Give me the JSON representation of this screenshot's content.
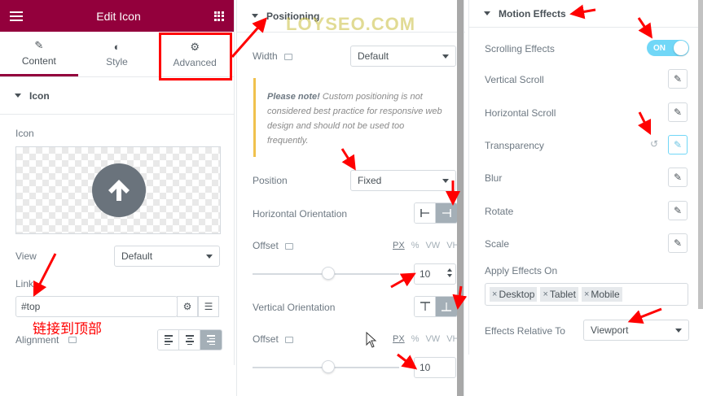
{
  "panel1": {
    "header_title": "Edit Icon",
    "tabs": [
      {
        "label": "Content",
        "icon": "pencil-icon",
        "active": true
      },
      {
        "label": "Style",
        "icon": "contrast-icon",
        "active": false
      },
      {
        "label": "Advanced",
        "icon": "gear-icon",
        "active": false
      }
    ],
    "section_title": "Icon",
    "icon_label": "Icon",
    "view_label": "View",
    "view_value": "Default",
    "link_label": "Link",
    "link_value": "#top",
    "alignment_label": "Alignment",
    "annotation_text": "链接到顶部"
  },
  "panel2": {
    "section_title": "Positioning",
    "watermark": "LOYSEO.COM",
    "width_label": "Width",
    "width_value": "Default",
    "note_bold": "Please note!",
    "note_text": " Custom positioning is not considered best practice for responsive web design and should not be used too frequently.",
    "position_label": "Position",
    "position_value": "Fixed",
    "h_orientation_label": "Horizontal Orientation",
    "offset_label": "Offset",
    "units": [
      "PX",
      "%",
      "VW",
      "VH"
    ],
    "h_offset_value": "10",
    "v_orientation_label": "Vertical Orientation",
    "v_offset_value": "10"
  },
  "panel3": {
    "section_title": "Motion Effects",
    "scrolling_effects_label": "Scrolling Effects",
    "toggle_text": "ON",
    "effects": [
      "Vertical Scroll",
      "Horizontal Scroll",
      "Transparency",
      "Blur",
      "Rotate",
      "Scale"
    ],
    "apply_effects_label": "Apply Effects On",
    "devices": [
      "Desktop",
      "Tablet",
      "Mobile"
    ],
    "relative_label": "Effects Relative To",
    "relative_value": "Viewport"
  },
  "colors": {
    "brand": "#93003c",
    "toggle_on": "#71d7f7",
    "annotation_red": "#ff0000",
    "note_border": "#f0c14d"
  }
}
